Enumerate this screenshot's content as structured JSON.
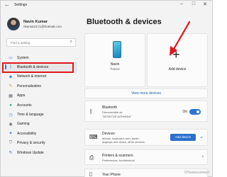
{
  "window": {
    "title": "Settings",
    "back_glyph": "←",
    "minimize_glyph": "–",
    "maximize_glyph": "□",
    "close_glyph": "✕"
  },
  "user": {
    "name": "Navin Kumar",
    "email": "nkumar2171@hotmail.com"
  },
  "search": {
    "placeholder": "Find a setting",
    "icon": "search-icon"
  },
  "nav": [
    {
      "label": "System",
      "icon": "monitor-icon",
      "glyph": "▭",
      "color": "#3d7bd6"
    },
    {
      "label": "Bluetooth & devices",
      "icon": "bluetooth-icon",
      "glyph": "ᛒ",
      "color": "#2c74d6",
      "active": true
    },
    {
      "label": "Network & internet",
      "icon": "wifi-icon",
      "glyph": "◆",
      "color": "#4a8bd8"
    },
    {
      "label": "Personalization",
      "icon": "brush-icon",
      "glyph": "✎",
      "color": "#d98a2b"
    },
    {
      "label": "Apps",
      "icon": "apps-icon",
      "glyph": "▦",
      "color": "#5a6a7a"
    },
    {
      "label": "Accounts",
      "icon": "person-icon",
      "glyph": "●",
      "color": "#2e9b5e"
    },
    {
      "label": "Time & language",
      "icon": "globe-clock-icon",
      "glyph": "◷",
      "color": "#3a8bd3"
    },
    {
      "label": "Gaming",
      "icon": "gamepad-icon",
      "glyph": "◉",
      "color": "#6b6b6b"
    },
    {
      "label": "Accessibility",
      "icon": "accessibility-icon",
      "glyph": "✦",
      "color": "#2f6fbd"
    },
    {
      "label": "Privacy & security",
      "icon": "shield-icon",
      "glyph": "⛉",
      "color": "#6b6b6b"
    },
    {
      "label": "Windows Update",
      "icon": "update-icon",
      "glyph": "↻",
      "color": "#2c74d6"
    }
  ],
  "main": {
    "title": "Bluetooth & devices",
    "device_card": {
      "name": "Navin",
      "status": "Paired",
      "icon": "phone-icon"
    },
    "add_card": {
      "label": "Add device",
      "glyph": "+",
      "icon": "plus-icon"
    },
    "view_more": "View more devices",
    "bluetooth": {
      "title": "Bluetooth",
      "sub1": "Discoverable as",
      "sub2": "\"DESKTOP-A0HH6DK\"",
      "toggle_label": "On",
      "toggle_on": true,
      "icon": "bluetooth-icon",
      "glyph": "ᛒ"
    },
    "devices": {
      "title": "Devices",
      "sub1": "Mouse, keyboard, pen, audio,",
      "sub2": "displays and docks, other devices",
      "button": "Add device",
      "icon": "keyboard-icon",
      "glyph": "⌨",
      "chevron": "⌄"
    },
    "printers": {
      "title": "Printers & scanners",
      "sub": "Preferences, troubleshoot",
      "icon": "printer-icon",
      "glyph": "⎙",
      "chevron": "›"
    },
    "phone": {
      "title": "Your Phone",
      "icon": "phone-link-icon",
      "glyph": "▯"
    }
  },
  "annotation_color": "#e0161b",
  "watermark": "©Howtoconnect"
}
